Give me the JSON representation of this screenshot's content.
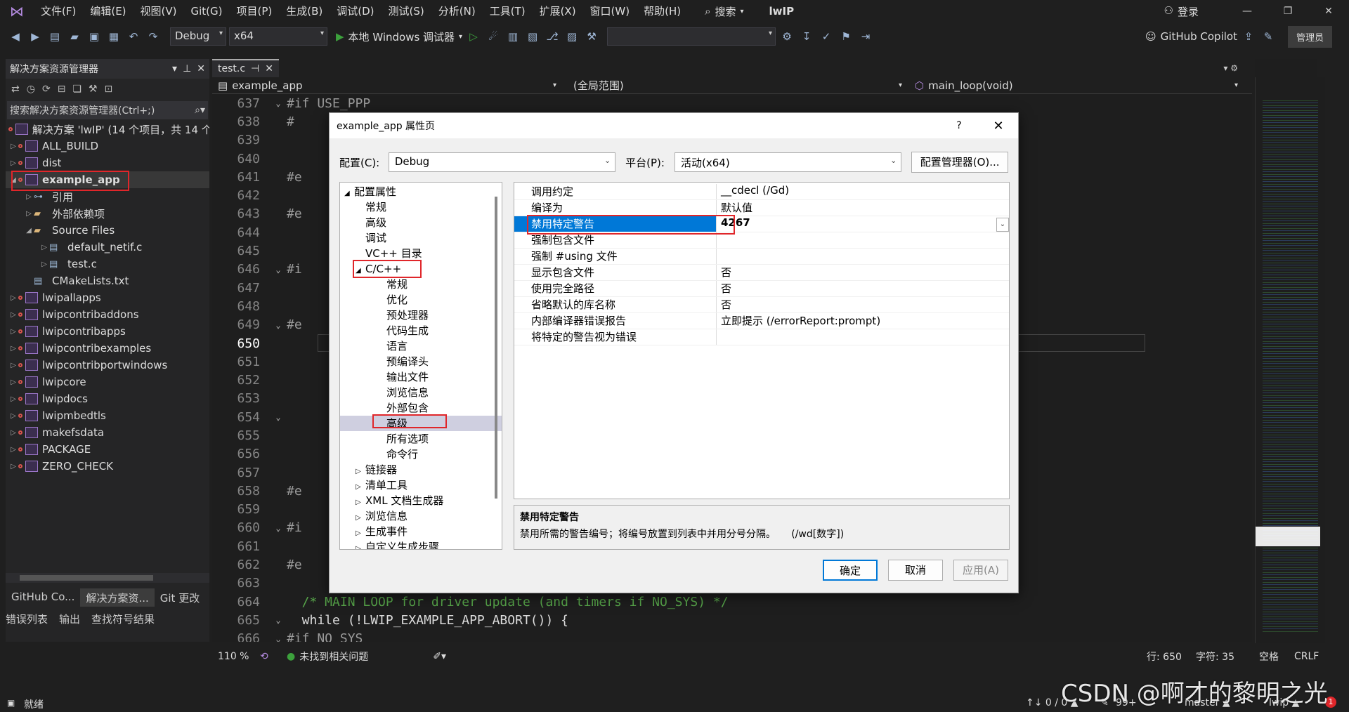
{
  "menubar": {
    "items": [
      "文件(F)",
      "编辑(E)",
      "视图(V)",
      "Git(G)",
      "项目(P)",
      "生成(B)",
      "调试(D)",
      "测试(S)",
      "分析(N)",
      "工具(T)",
      "扩展(X)",
      "窗口(W)",
      "帮助(H)"
    ],
    "search_label": "搜索",
    "solution_name": "lwIP",
    "login_label": "登录"
  },
  "toolbar": {
    "config_value": "Debug",
    "platform_value": "x64",
    "debugger_label": "本地 Windows 调试器",
    "copilot_label": "GitHub Copilot",
    "admin_label": "管理员"
  },
  "solution_explorer": {
    "title": "解决方案资源管理器",
    "search_placeholder": "搜索解决方案资源管理器(Ctrl+;)",
    "solution_label": "解决方案 'lwIP' (14 个项目，共 14 个",
    "items": [
      {
        "label": "ALL_BUILD",
        "level": 1,
        "twisty": "▷",
        "type": "project"
      },
      {
        "label": "dist",
        "level": 1,
        "twisty": "▷",
        "type": "project"
      },
      {
        "label": "example_app",
        "level": 1,
        "twisty": "◢",
        "type": "project",
        "bold": true
      },
      {
        "label": "引用",
        "level": 2,
        "twisty": "▷",
        "type": "ref"
      },
      {
        "label": "外部依赖项",
        "level": 2,
        "twisty": "▷",
        "type": "folder"
      },
      {
        "label": "Source Files",
        "level": 2,
        "twisty": "◢",
        "type": "folder"
      },
      {
        "label": "default_netif.c",
        "level": 3,
        "twisty": "▷",
        "type": "file"
      },
      {
        "label": "test.c",
        "level": 3,
        "twisty": "▷",
        "type": "file"
      },
      {
        "label": "CMakeLists.txt",
        "level": 2,
        "twisty": "",
        "type": "file"
      },
      {
        "label": "lwipallapps",
        "level": 1,
        "twisty": "▷",
        "type": "project"
      },
      {
        "label": "lwipcontribaddons",
        "level": 1,
        "twisty": "▷",
        "type": "project"
      },
      {
        "label": "lwipcontribapps",
        "level": 1,
        "twisty": "▷",
        "type": "project"
      },
      {
        "label": "lwipcontribexamples",
        "level": 1,
        "twisty": "▷",
        "type": "project"
      },
      {
        "label": "lwipcontribportwindows",
        "level": 1,
        "twisty": "▷",
        "type": "project"
      },
      {
        "label": "lwipcore",
        "level": 1,
        "twisty": "▷",
        "type": "project"
      },
      {
        "label": "lwipdocs",
        "level": 1,
        "twisty": "▷",
        "type": "project"
      },
      {
        "label": "lwipmbedtls",
        "level": 1,
        "twisty": "▷",
        "type": "project"
      },
      {
        "label": "makefsdata",
        "level": 1,
        "twisty": "▷",
        "type": "project"
      },
      {
        "label": "PACKAGE",
        "level": 1,
        "twisty": "▷",
        "type": "project"
      },
      {
        "label": "ZERO_CHECK",
        "level": 1,
        "twisty": "▷",
        "type": "project"
      }
    ],
    "bottom_tabs": [
      "GitHub Co...",
      "解决方案资...",
      "Git 更改"
    ]
  },
  "editor": {
    "tab_label": "test.c",
    "nav_project": "example_app",
    "nav_scope": "(全局范围)",
    "nav_function": "main_loop(void)",
    "lines": [
      {
        "n": "637",
        "fold": "⌄",
        "text": "#if USE_PPP",
        "kind": "pp"
      },
      {
        "n": "638",
        "fold": "",
        "text": "#",
        "kind": "pp"
      },
      {
        "n": "639",
        "fold": "",
        "text": "",
        "kind": "plain"
      },
      {
        "n": "640",
        "fold": "",
        "text": "",
        "kind": "plain"
      },
      {
        "n": "641",
        "fold": "",
        "text": "#e",
        "kind": "pp"
      },
      {
        "n": "642",
        "fold": "",
        "text": "",
        "kind": "plain"
      },
      {
        "n": "643",
        "fold": "",
        "text": "#e",
        "kind": "pp"
      },
      {
        "n": "644",
        "fold": "",
        "text": "",
        "kind": "plain"
      },
      {
        "n": "645",
        "fold": "",
        "text": "",
        "kind": "plain"
      },
      {
        "n": "646",
        "fold": "⌄",
        "text": "#i",
        "kind": "pp"
      },
      {
        "n": "647",
        "fold": "",
        "text": "",
        "kind": "plain"
      },
      {
        "n": "648",
        "fold": "",
        "text": "",
        "kind": "plain"
      },
      {
        "n": "649",
        "fold": "⌄",
        "text": "#e",
        "kind": "pp"
      },
      {
        "n": "650",
        "fold": "",
        "text": "",
        "kind": "plain"
      },
      {
        "n": "651",
        "fold": "",
        "text": "",
        "kind": "plain"
      },
      {
        "n": "652",
        "fold": "",
        "text": "",
        "kind": "plain"
      },
      {
        "n": "653",
        "fold": "",
        "text": "",
        "kind": "plain"
      },
      {
        "n": "654",
        "fold": "⌄",
        "text": "",
        "kind": "plain"
      },
      {
        "n": "655",
        "fold": "",
        "text": "",
        "kind": "plain"
      },
      {
        "n": "656",
        "fold": "",
        "text": "",
        "kind": "plain"
      },
      {
        "n": "657",
        "fold": "",
        "text": "",
        "kind": "plain"
      },
      {
        "n": "658",
        "fold": "",
        "text": "#e",
        "kind": "pp"
      },
      {
        "n": "659",
        "fold": "",
        "text": "",
        "kind": "plain"
      },
      {
        "n": "660",
        "fold": "⌄",
        "text": "#i",
        "kind": "pp"
      },
      {
        "n": "661",
        "fold": "",
        "text": "",
        "kind": "plain"
      },
      {
        "n": "662",
        "fold": "",
        "text": "#e",
        "kind": "pp"
      },
      {
        "n": "663",
        "fold": "",
        "text": "",
        "kind": "plain"
      },
      {
        "n": "664",
        "fold": "",
        "text": "  /* MAIN LOOP for driver update (and timers if NO_SYS) */",
        "kind": "comment"
      },
      {
        "n": "665",
        "fold": "⌄",
        "text": "  while (!LWIP_EXAMPLE_APP_ABORT()) {",
        "kind": "code"
      },
      {
        "n": "666",
        "fold": "⌄",
        "text": "#if NO_SYS",
        "kind": "pp"
      }
    ],
    "zoom": "110 %",
    "issues_label": "未找到相关问题",
    "line_label": "行: 650",
    "char_label": "字符: 35",
    "space_label": "空格",
    "eol_label": "CRLF"
  },
  "dialog": {
    "title": "example_app 属性页",
    "help": "?",
    "config_label": "配置(C):",
    "config_value": "Debug",
    "platform_label": "平台(P):",
    "platform_value": "活动(x64)",
    "config_manager_label": "配置管理器(O)...",
    "tree": [
      {
        "label": "配置属性",
        "indent": 0,
        "twisty": "◢"
      },
      {
        "label": "常规",
        "indent": 1,
        "twisty": ""
      },
      {
        "label": "高级",
        "indent": 1,
        "twisty": ""
      },
      {
        "label": "调试",
        "indent": 1,
        "twisty": ""
      },
      {
        "label": "VC++ 目录",
        "indent": 1,
        "twisty": ""
      },
      {
        "label": "C/C++",
        "indent": 1,
        "twisty": "◢"
      },
      {
        "label": "常规",
        "indent": 2,
        "twisty": ""
      },
      {
        "label": "优化",
        "indent": 2,
        "twisty": ""
      },
      {
        "label": "预处理器",
        "indent": 2,
        "twisty": ""
      },
      {
        "label": "代码生成",
        "indent": 2,
        "twisty": ""
      },
      {
        "label": "语言",
        "indent": 2,
        "twisty": ""
      },
      {
        "label": "预编译头",
        "indent": 2,
        "twisty": ""
      },
      {
        "label": "输出文件",
        "indent": 2,
        "twisty": ""
      },
      {
        "label": "浏览信息",
        "indent": 2,
        "twisty": ""
      },
      {
        "label": "外部包含",
        "indent": 2,
        "twisty": ""
      },
      {
        "label": "高级",
        "indent": 2,
        "twisty": "",
        "selected": true
      },
      {
        "label": "所有选项",
        "indent": 2,
        "twisty": ""
      },
      {
        "label": "命令行",
        "indent": 2,
        "twisty": ""
      },
      {
        "label": "链接器",
        "indent": 1,
        "twisty": "▷"
      },
      {
        "label": "清单工具",
        "indent": 1,
        "twisty": "▷"
      },
      {
        "label": "XML 文档生成器",
        "indent": 1,
        "twisty": "▷"
      },
      {
        "label": "浏览信息",
        "indent": 1,
        "twisty": "▷"
      },
      {
        "label": "生成事件",
        "indent": 1,
        "twisty": "▷"
      },
      {
        "label": "自定义生成步骤",
        "indent": 1,
        "twisty": "▷"
      }
    ],
    "properties": [
      {
        "name": "调用约定",
        "value": "__cdecl (/Gd)"
      },
      {
        "name": "编译为",
        "value": "默认值"
      },
      {
        "name": "禁用特定警告",
        "value": "4267",
        "selected": true
      },
      {
        "name": "强制包含文件",
        "value": ""
      },
      {
        "name": "强制 #using 文件",
        "value": ""
      },
      {
        "name": "显示包含文件",
        "value": "否"
      },
      {
        "name": "使用完全路径",
        "value": "否"
      },
      {
        "name": "省略默认的库名称",
        "value": "否"
      },
      {
        "name": "内部编译器错误报告",
        "value": "立即提示 (/errorReport:prompt)"
      },
      {
        "name": "将特定的警告视为错误",
        "value": ""
      }
    ],
    "desc_title": "禁用特定警告",
    "desc_text": "禁用所需的警告编号；将编号放置到列表中并用分号分隔。     (/wd[数字])",
    "ok_label": "确定",
    "cancel_label": "取消",
    "apply_label": "应用(A)"
  },
  "bottom_tabs": [
    "错误列表",
    "输出",
    "查找符号结果"
  ],
  "statusbar": {
    "ready": "就绪",
    "git_counts": "↑↓ 0 / 0 ▲",
    "edits": "99+",
    "branch": "master ▲",
    "repo": "lwip ▲",
    "watermark": "CSDN @啊才的黎明之光"
  },
  "colors": {
    "accent_blue": "#0078d7",
    "highlight_red": "#e0262a",
    "keyword_blue": "#569cd6",
    "comment_green": "#57a64a"
  }
}
